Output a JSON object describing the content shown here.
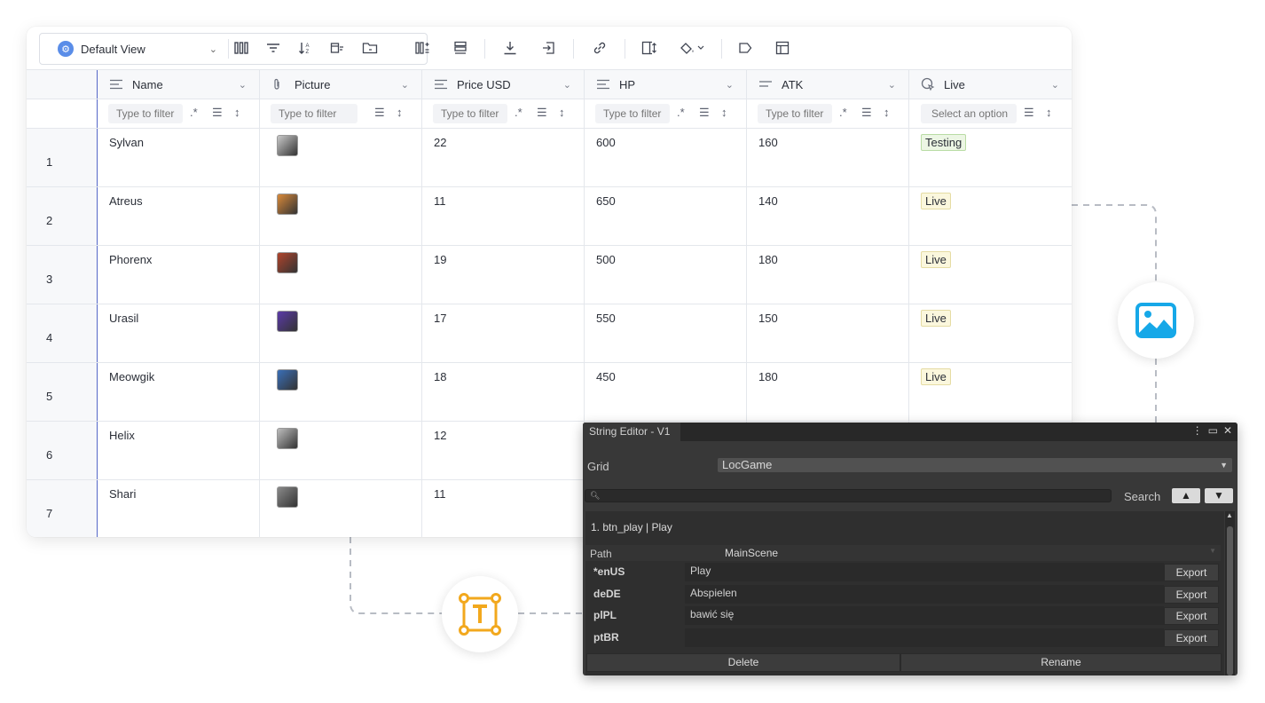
{
  "toolbar": {
    "view_label": "Default View",
    "icons": [
      "columns-icon",
      "filter-icon",
      "sort-icon",
      "group-icon",
      "folder-icon",
      "fields-icon",
      "row-height-icon",
      "download-icon",
      "import-icon",
      "link-icon",
      "freeze-icon",
      "paint-bucket-icon",
      "tag-icon",
      "layout-icon"
    ]
  },
  "columns": [
    {
      "name": "Name",
      "icon": "text-icon",
      "filter_placeholder": "Type to filter"
    },
    {
      "name": "Picture",
      "icon": "attachment-icon",
      "filter_placeholder": "Type to filter"
    },
    {
      "name": "Price USD",
      "icon": "text-icon",
      "filter_placeholder": "Type to filter"
    },
    {
      "name": "HP",
      "icon": "text-icon",
      "filter_placeholder": "Type to filter"
    },
    {
      "name": "ATK",
      "icon": "text-icon",
      "filter_placeholder": "Type to filter"
    },
    {
      "name": "Live",
      "icon": "select-icon",
      "filter_placeholder": "Select an option"
    }
  ],
  "rows": [
    {
      "num": "1",
      "name": "Sylvan",
      "price": "22",
      "hp": "600",
      "atk": "160",
      "live": "Testing"
    },
    {
      "num": "2",
      "name": "Atreus",
      "price": "11",
      "hp": "650",
      "atk": "140",
      "live": "Live"
    },
    {
      "num": "3",
      "name": "Phorenx",
      "price": "19",
      "hp": "500",
      "atk": "180",
      "live": "Live"
    },
    {
      "num": "4",
      "name": "Urasil",
      "price": "17",
      "hp": "550",
      "atk": "150",
      "live": "Live"
    },
    {
      "num": "5",
      "name": "Meowgik",
      "price": "18",
      "hp": "450",
      "atk": "180",
      "live": "Live"
    },
    {
      "num": "6",
      "name": "Helix",
      "price": "12",
      "hp": "",
      "atk": "",
      "live": ""
    },
    {
      "num": "7",
      "name": "Shari",
      "price": "11",
      "hp": "",
      "atk": "",
      "live": ""
    }
  ],
  "picture_colors": [
    "#c9c9c9",
    "#d98a3a",
    "#b0442c",
    "#5b3aa8",
    "#3a6fb8",
    "#bdbdbd",
    "#8a8a8a"
  ],
  "editor": {
    "tab_title": "String Editor - V1",
    "grid_label": "Grid",
    "grid_value": "LocGame",
    "search_label": "Search",
    "entry_title": "1. btn_play | Play",
    "path_label": "Path",
    "path_value": "MainScene",
    "locales": [
      {
        "lang": "*enUS",
        "value": "Play",
        "export": "Export"
      },
      {
        "lang": "deDE",
        "value": "Abspielen",
        "export": "Export"
      },
      {
        "lang": "plPL",
        "value": "bawić się",
        "export": "Export"
      },
      {
        "lang": "ptBR",
        "value": "",
        "export": "Export"
      }
    ],
    "delete_label": "Delete",
    "rename_label": "Rename"
  }
}
